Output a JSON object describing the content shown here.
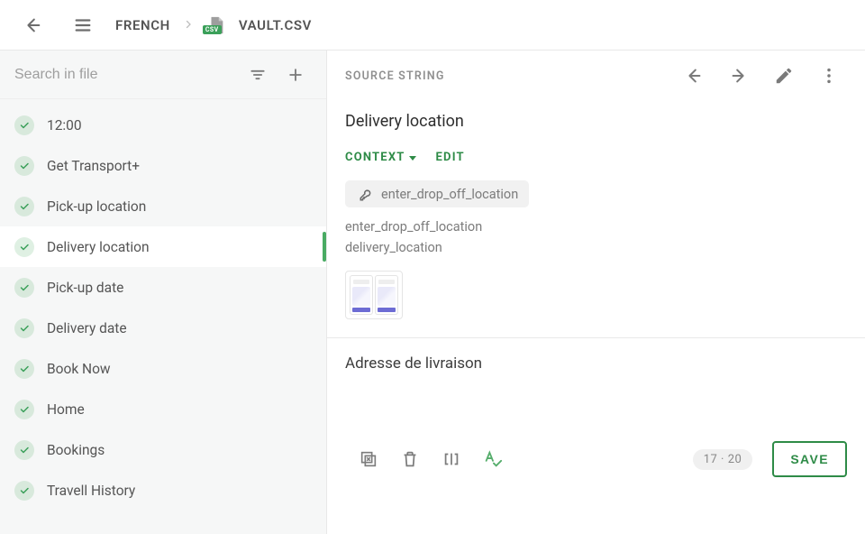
{
  "breadcrumb": {
    "language": "FRENCH",
    "file_label": "VAULT.CSV",
    "csv_tag": "CSV"
  },
  "search": {
    "placeholder": "Search in file"
  },
  "list": {
    "items": [
      {
        "label": "12:00",
        "selected": false
      },
      {
        "label": "Get Transport+",
        "selected": false
      },
      {
        "label": "Pick-up location",
        "selected": false
      },
      {
        "label": "Delivery location",
        "selected": true
      },
      {
        "label": "Pick-up date",
        "selected": false
      },
      {
        "label": "Delivery date",
        "selected": false
      },
      {
        "label": "Book Now",
        "selected": false
      },
      {
        "label": "Home",
        "selected": false
      },
      {
        "label": "Bookings",
        "selected": false
      },
      {
        "label": "Travell History",
        "selected": false
      }
    ]
  },
  "main": {
    "section_label": "SOURCE STRING",
    "source_string": "Delivery location",
    "context_label": "CONTEXT",
    "edit_label": "EDIT",
    "key": "enter_drop_off_location",
    "context_lines": [
      "enter_drop_off_location",
      "delivery_location"
    ],
    "translation": "Adresse de livraison",
    "char_count": "17",
    "char_sep": "·",
    "char_max": "20",
    "save_label": "SAVE"
  }
}
